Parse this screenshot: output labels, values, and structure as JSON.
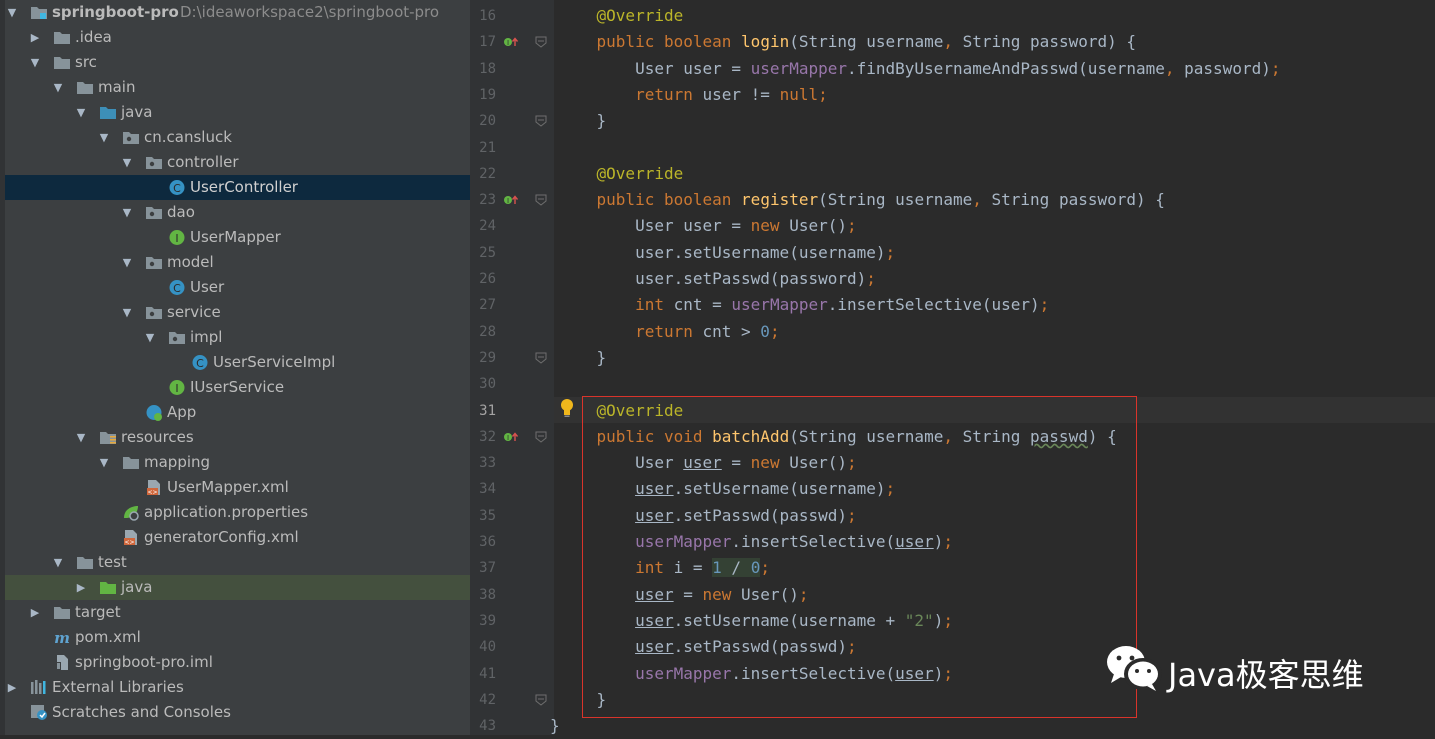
{
  "project_tree": {
    "rows": [
      {
        "label": "springboot-pro",
        "path": "D:\\ideaworkspace2\\springboot-pro",
        "icon": "module-folder-icon",
        "expanded": true
      },
      {
        "label": ".idea",
        "icon": "folder-icon",
        "expanded": false
      },
      {
        "label": "src",
        "icon": "folder-icon",
        "expanded": true
      },
      {
        "label": "main",
        "icon": "folder-icon",
        "expanded": true
      },
      {
        "label": "java",
        "icon": "source-root-folder-icon",
        "expanded": true
      },
      {
        "label": "cn.cansluck",
        "icon": "package-icon",
        "expanded": true
      },
      {
        "label": "controller",
        "icon": "package-icon",
        "expanded": true
      },
      {
        "label": "UserController",
        "icon": "class-icon",
        "selected": true
      },
      {
        "label": "dao",
        "icon": "package-icon",
        "expanded": true
      },
      {
        "label": "UserMapper",
        "icon": "interface-icon"
      },
      {
        "label": "model",
        "icon": "package-icon",
        "expanded": true
      },
      {
        "label": "User",
        "icon": "class-icon"
      },
      {
        "label": "service",
        "icon": "package-icon",
        "expanded": true
      },
      {
        "label": "impl",
        "icon": "package-icon",
        "expanded": true
      },
      {
        "label": "UserServiceImpl",
        "icon": "class-icon"
      },
      {
        "label": "IUserService",
        "icon": "interface-icon"
      },
      {
        "label": "App",
        "icon": "spring-boot-app-icon"
      },
      {
        "label": "resources",
        "icon": "resources-folder-icon",
        "expanded": true
      },
      {
        "label": "mapping",
        "icon": "folder-icon",
        "expanded": true
      },
      {
        "label": "UserMapper.xml",
        "icon": "xml-file-icon"
      },
      {
        "label": "application.properties",
        "icon": "spring-properties-icon"
      },
      {
        "label": "generatorConfig.xml",
        "icon": "xml-file-icon"
      },
      {
        "label": "test",
        "icon": "folder-icon",
        "expanded": true
      },
      {
        "label": "java",
        "icon": "test-root-folder-icon",
        "expanded": false
      },
      {
        "label": "target",
        "icon": "folder-icon",
        "expanded": false
      },
      {
        "label": "pom.xml",
        "icon": "maven-icon"
      },
      {
        "label": "springboot-pro.iml",
        "icon": "iml-file-icon"
      },
      {
        "label": "External Libraries",
        "icon": "libraries-icon",
        "expanded": false
      },
      {
        "label": "Scratches and Consoles",
        "icon": "scratches-icon"
      }
    ]
  },
  "editor": {
    "current_line": 31,
    "lines": [
      {
        "n": 16,
        "code": "    @Override"
      },
      {
        "n": 17,
        "code": "    public boolean login(String username, String password) {"
      },
      {
        "n": 18,
        "code": "        User user = userMapper.findByUsernameAndPasswd(username, password);"
      },
      {
        "n": 19,
        "code": "        return user != null;"
      },
      {
        "n": 20,
        "code": "    }"
      },
      {
        "n": 21,
        "code": ""
      },
      {
        "n": 22,
        "code": "    @Override"
      },
      {
        "n": 23,
        "code": "    public boolean register(String username, String password) {"
      },
      {
        "n": 24,
        "code": "        User user = new User();"
      },
      {
        "n": 25,
        "code": "        user.setUsername(username);"
      },
      {
        "n": 26,
        "code": "        user.setPasswd(password);"
      },
      {
        "n": 27,
        "code": "        int cnt = userMapper.insertSelective(user);"
      },
      {
        "n": 28,
        "code": "        return cnt > 0;"
      },
      {
        "n": 29,
        "code": "    }"
      },
      {
        "n": 30,
        "code": ""
      },
      {
        "n": 31,
        "code": "    @Override"
      },
      {
        "n": 32,
        "code": "    public void batchAdd(String username, String passwd) {"
      },
      {
        "n": 33,
        "code": "        User user = new User();"
      },
      {
        "n": 34,
        "code": "        user.setUsername(username);"
      },
      {
        "n": 35,
        "code": "        user.setPasswd(passwd);"
      },
      {
        "n": 36,
        "code": "        userMapper.insertSelective(user);"
      },
      {
        "n": 37,
        "code": "        int i = 1 / 0;"
      },
      {
        "n": 38,
        "code": "        user = new User();"
      },
      {
        "n": 39,
        "code": "        user.setUsername(username + \"2\");"
      },
      {
        "n": 40,
        "code": "        user.setPasswd(passwd);"
      },
      {
        "n": 41,
        "code": "        userMapper.insertSelective(user);"
      },
      {
        "n": 42,
        "code": "    }"
      },
      {
        "n": 43,
        "code": "}"
      }
    ]
  },
  "watermark": {
    "text": "Java极客思维",
    "icon": "wechat-icon"
  },
  "colors": {
    "keyword": "#cc7832",
    "annotation": "#bbb529",
    "method_decl": "#ffc66d",
    "field": "#9876aa",
    "number": "#6897bb",
    "string": "#6a8759",
    "highlight_box": "#d9342b"
  }
}
